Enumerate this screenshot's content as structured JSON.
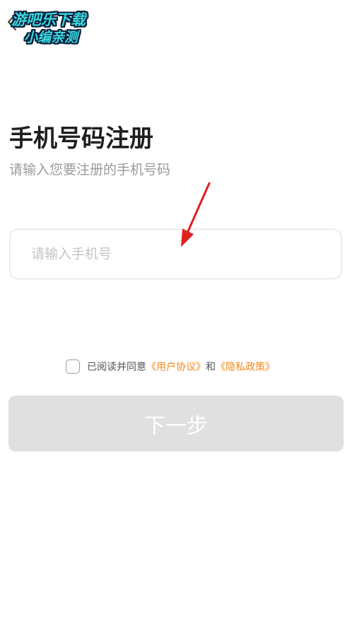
{
  "header": {
    "back_icon": "chevron-left-icon",
    "watermark_line1": "游吧乐下载",
    "watermark_line2": "小编亲测"
  },
  "main": {
    "title": "手机号码注册",
    "subtitle": "请输入您要注册的手机号码",
    "phone_input": {
      "value": "",
      "placeholder": "请输入手机号"
    },
    "agreement": {
      "prefix": "已阅读并同意",
      "user_agreement": "《用户协议》",
      "conjunction": "和",
      "privacy_policy": "《隐私政策》",
      "checked": false
    },
    "next_button": "下一步"
  },
  "colors": {
    "link": "#f08a1c",
    "button_disabled_bg": "#e0e0e0",
    "annotation_arrow": "#e02020",
    "watermark": "#3ad7df"
  }
}
